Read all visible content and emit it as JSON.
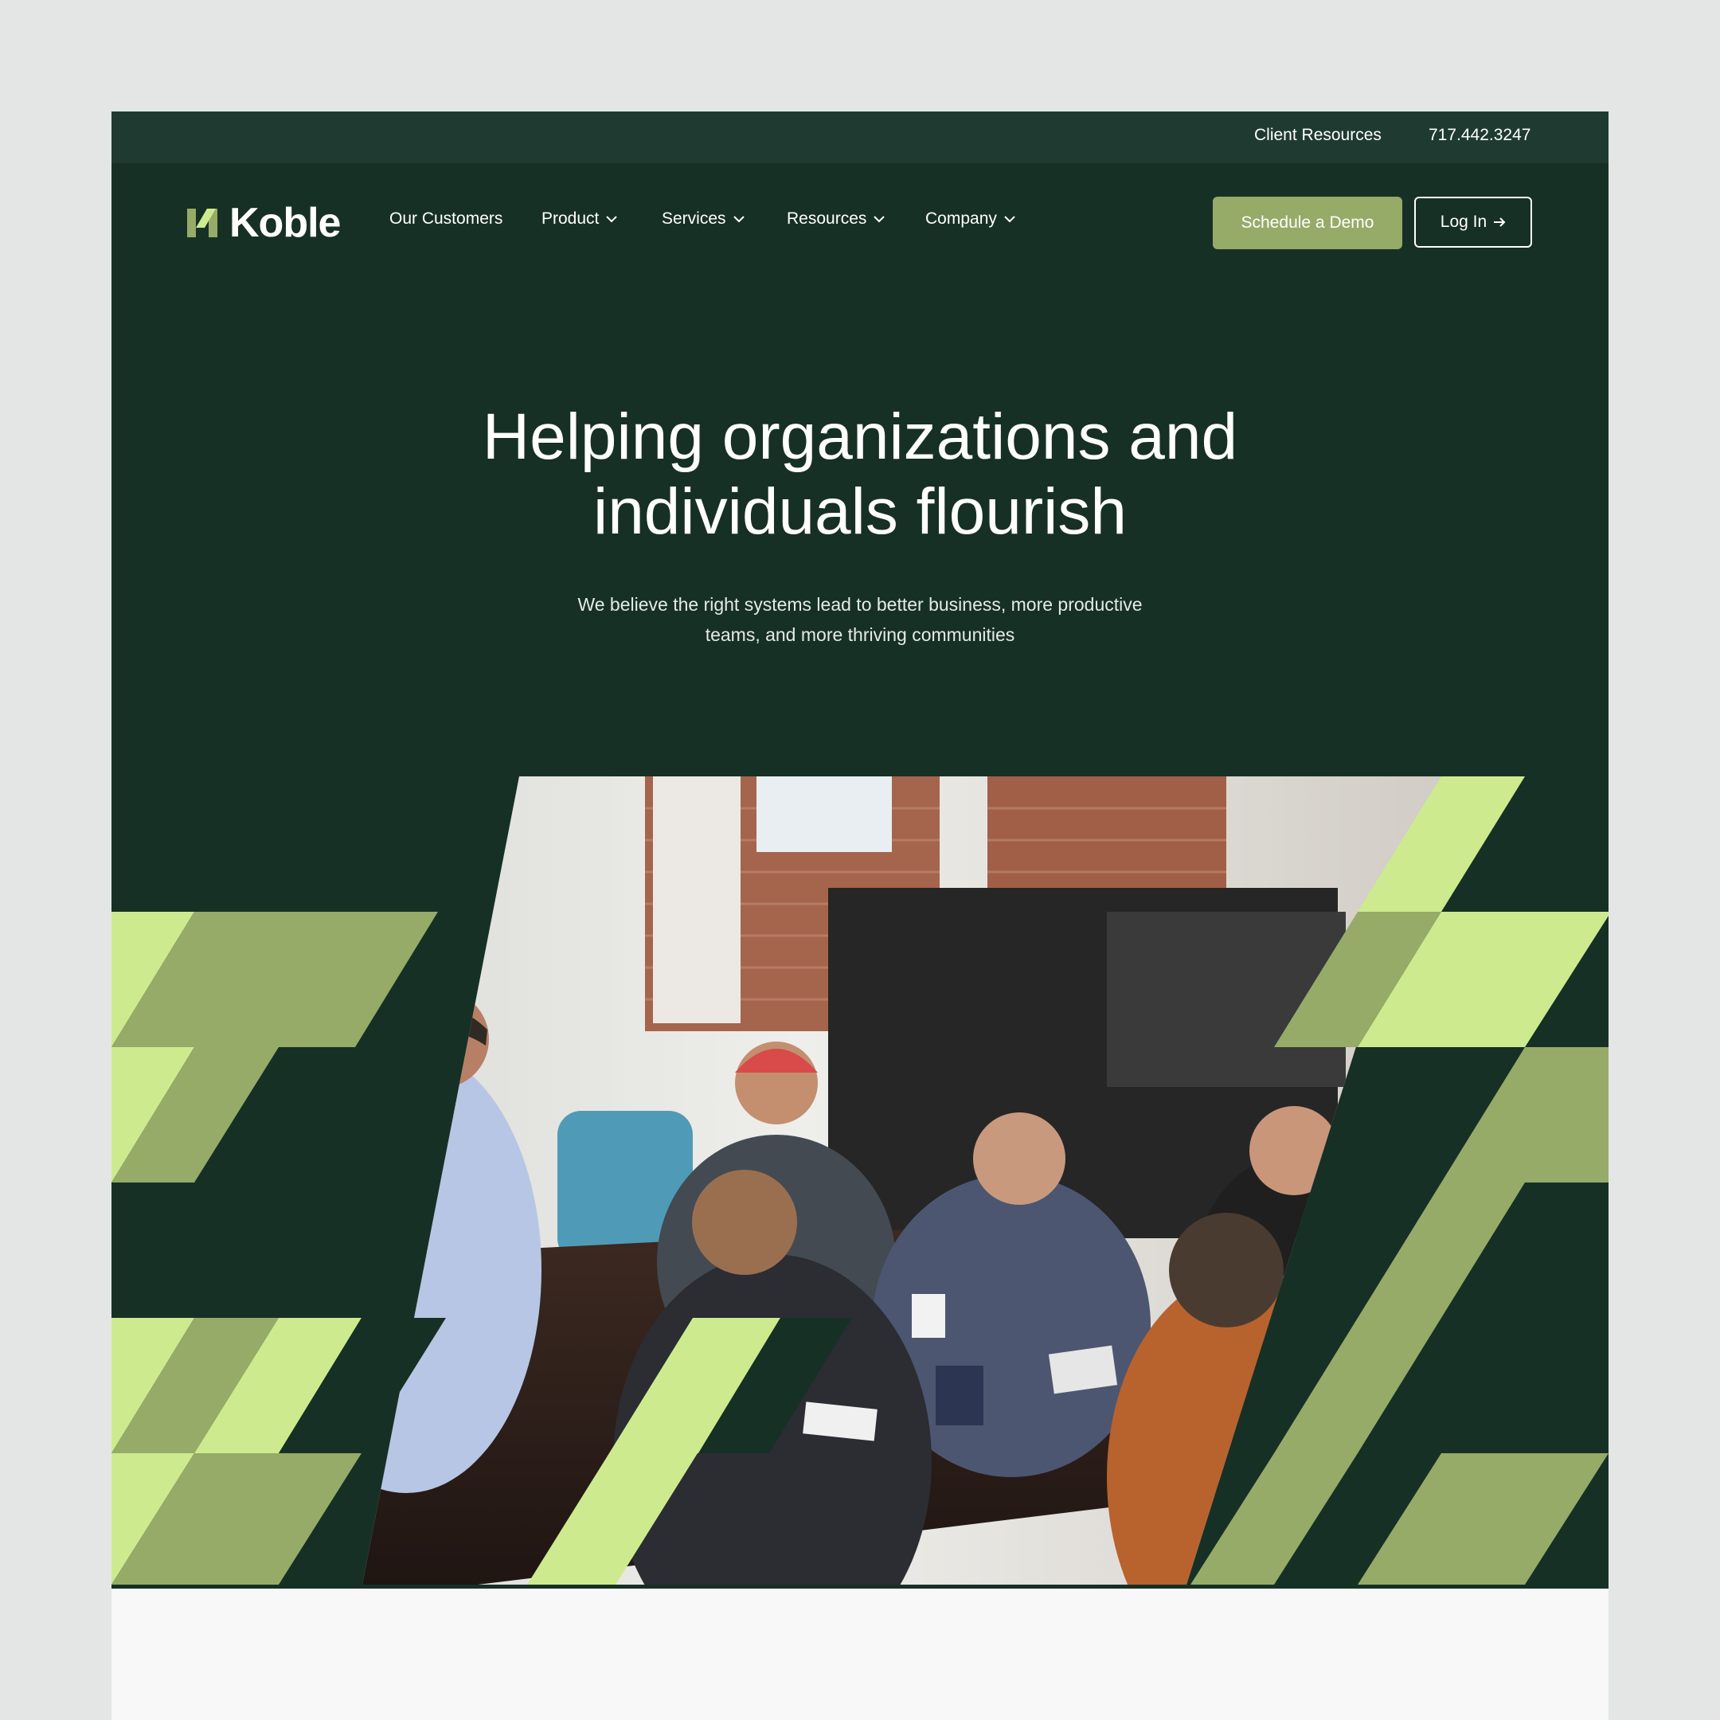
{
  "top_bar": {
    "client_resources": "Client Resources",
    "phone": "717.442.3247"
  },
  "brand": {
    "name": "Koble",
    "icon": "koble-logo-mark"
  },
  "nav": {
    "our_customers": "Our Customers",
    "product": "Product",
    "services": "Services",
    "resources": "Resources",
    "company": "Company"
  },
  "cta": {
    "schedule_demo": "Schedule a Demo",
    "login": "Log In"
  },
  "hero": {
    "title_line1": "Helping organizations and",
    "title_line2": "individuals flourish",
    "subtitle_line1": "We believe the right systems lead to better business, more productive",
    "subtitle_line2": "teams, and more thriving communities",
    "image_alt": "Team meeting around a conference table in an office"
  },
  "colors": {
    "dark_green": "#173026",
    "top_bar_green": "#1f3b31",
    "olive_green": "#96ab68",
    "lime_green": "#cdeb8e",
    "off_white": "#f7f8f7"
  }
}
